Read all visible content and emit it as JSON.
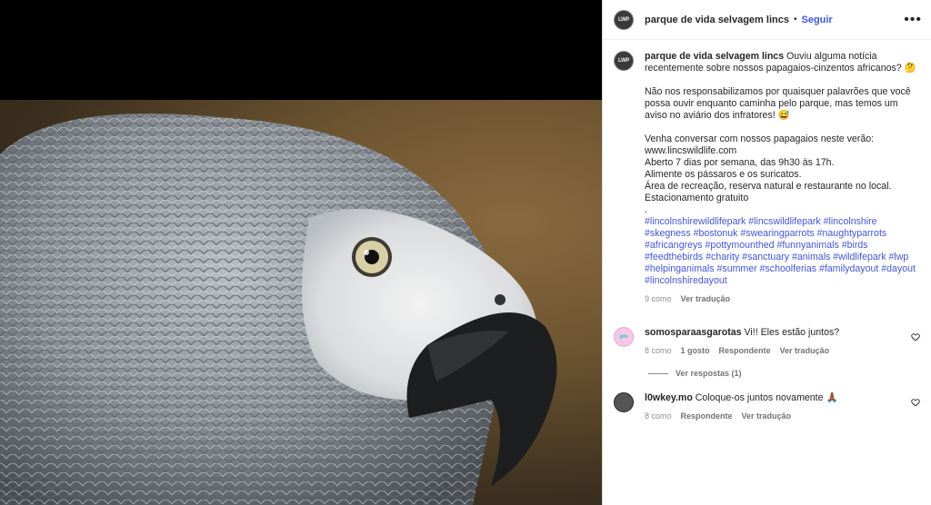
{
  "post": {
    "username": "parque de vida selvagem lincs",
    "avatar_text": "LWP",
    "separator": "•",
    "follow_label": "Seguir",
    "more_icon": "more-options-icon"
  },
  "caption": {
    "username": "parque de vida selvagem lincs",
    "text1": "Ouviu alguma notícia recentemente sobre nossos papagaios-cinzentos africanos? 🤔",
    "text2": "Não nos responsabilizamos por quaisquer palavrões que você possa ouvir enquanto caminha pelo parque, mas temos um aviso no aviário dos infratores! 😅",
    "line1": "Venha conversar com nossos papagaios neste verão:",
    "line2": "www.lincswildlife.com",
    "line3": "Aberto 7 dias por semana, das 9h30 às 17h.",
    "line4": "Alimente os pássaros e os suricatos.",
    "line5": "Área de recreação, reserva natural e restaurante no local.",
    "line6": "Estacionamento gratuito",
    "line7": ".",
    "hashtags": "#lincolnshirewildlifepark #lincswildlifepark #lincolnshire #skegness #bostonuk #swearingparrots #naughtyparrots #africangreys #pottymounthed #funnyanimals #birds #feedthebirds #charity #sanctuary #animals #wildlifepark #lwp #helpinganimals #summer #schoolferias #familydayout #dayout #lincolnshiredayout",
    "time": "9 como",
    "translate": "Ver tradução"
  },
  "comments": [
    {
      "username": "somosparaasgarotas",
      "text": "Vi!! Eles estão juntos?",
      "time": "8 como",
      "likes": "1 gosto",
      "reply": "Respondente",
      "translate": "Ver tradução",
      "avatar_text": "girls"
    },
    {
      "username": "l0wkey.mo",
      "text": "Coloque-os juntos novamente 🙏🏾",
      "time": "8 como",
      "reply": "Respondente",
      "translate": "Ver tradução",
      "avatar_text": ""
    }
  ],
  "view_replies": "Ver respostas (1)",
  "colors": {
    "link": "#4257d4",
    "muted": "#8e8e8e",
    "text": "#262626"
  }
}
